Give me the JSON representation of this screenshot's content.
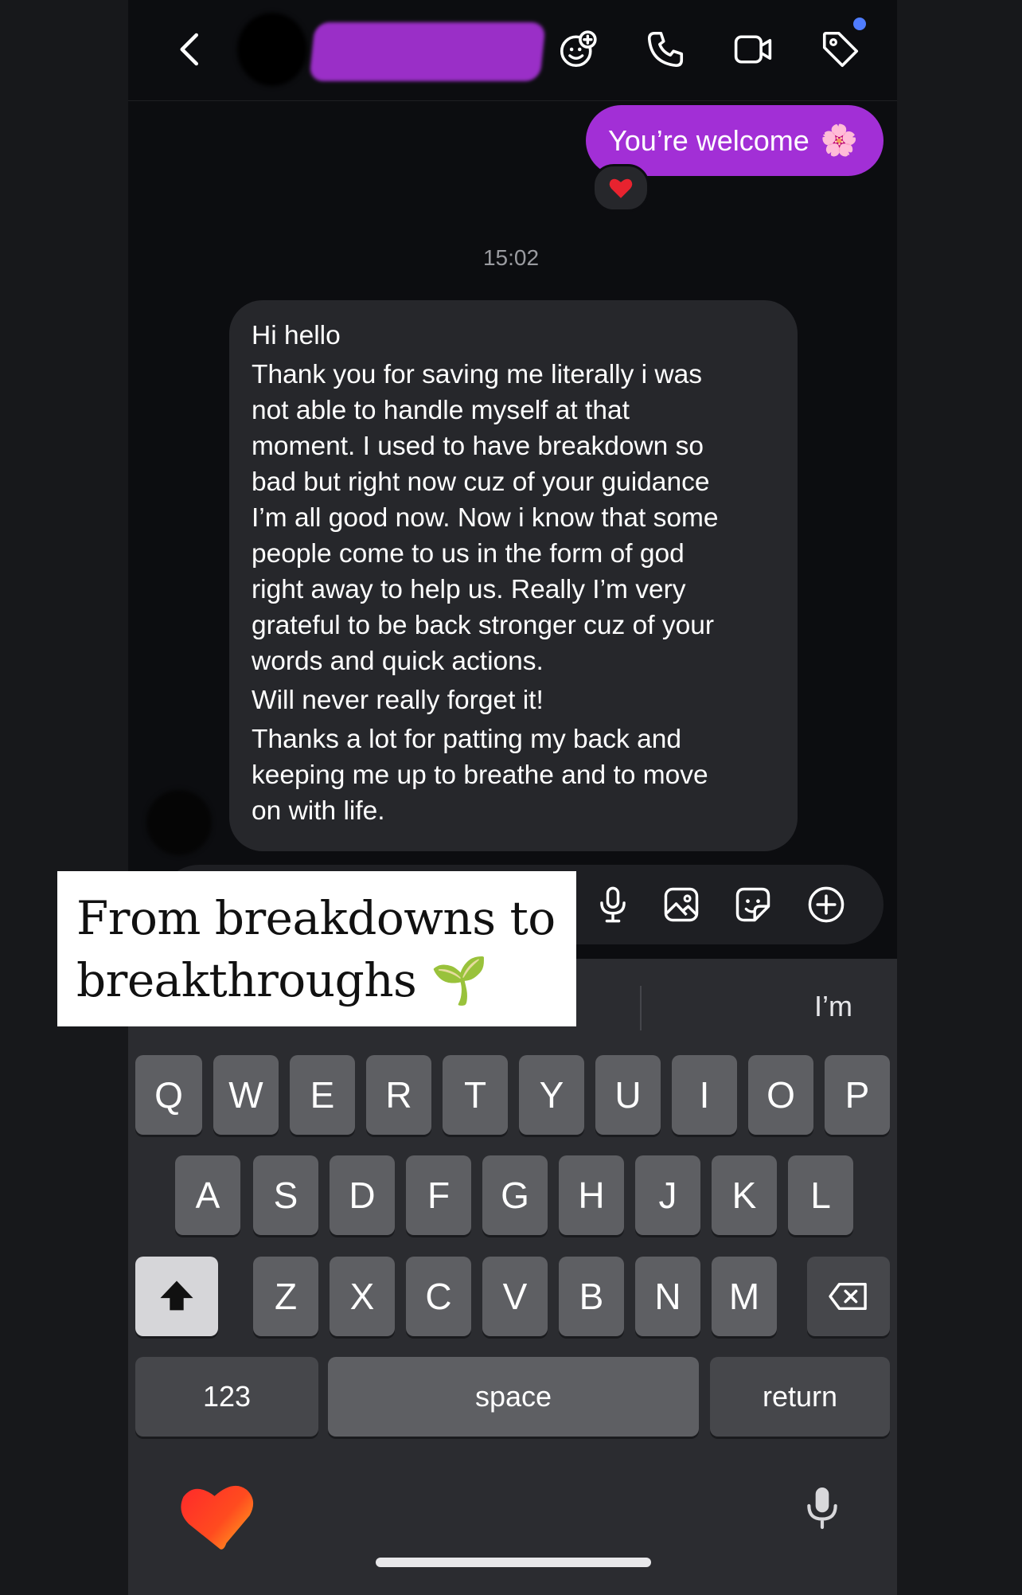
{
  "header": {
    "back_icon": "chevron-left-icon",
    "actions": [
      "add-effects-icon",
      "phone-icon",
      "video-icon",
      "tag-icon"
    ]
  },
  "thread": {
    "outgoing_message": "You’re welcome",
    "outgoing_emoji": "🌸",
    "reaction": "❤️",
    "timestamp": "15:02",
    "incoming_lines": [
      "Hi hello",
      "Thank you for saving me literally i was",
      "not able to handle myself at that",
      "moment. I used to have breakdown so",
      "bad but right now cuz of your guidance",
      "I’m all good now. Now i know that some",
      "people come to us in the form of god",
      "right away to help us. Really I’m very",
      "grateful to be back stronger cuz of your",
      "words and quick actions.",
      "Will never really forget it!",
      "Thanks a lot for patting my back and",
      "keeping me up to breathe and to move",
      "on with life."
    ]
  },
  "composer": {
    "icons": [
      "microphone-icon",
      "gallery-icon",
      "sticker-icon",
      "plus-icon"
    ]
  },
  "caption": {
    "line1": "From breakdowns to",
    "line2": "breakthroughs",
    "emoji": "🌱"
  },
  "keyboard": {
    "suggestion": "I’m",
    "row1": [
      "Q",
      "W",
      "E",
      "R",
      "T",
      "Y",
      "U",
      "I",
      "O",
      "P"
    ],
    "row2": [
      "A",
      "S",
      "D",
      "F",
      "G",
      "H",
      "J",
      "K",
      "L"
    ],
    "row3": [
      "Z",
      "X",
      "C",
      "V",
      "B",
      "N",
      "M"
    ],
    "numbers_label": "123",
    "space_label": "space",
    "return_label": "return"
  },
  "colors": {
    "outgoing_bubble": "#a22fd6",
    "incoming_bubble": "#26272b",
    "background": "#0c0d10",
    "keyboard": "#2b2c30"
  }
}
